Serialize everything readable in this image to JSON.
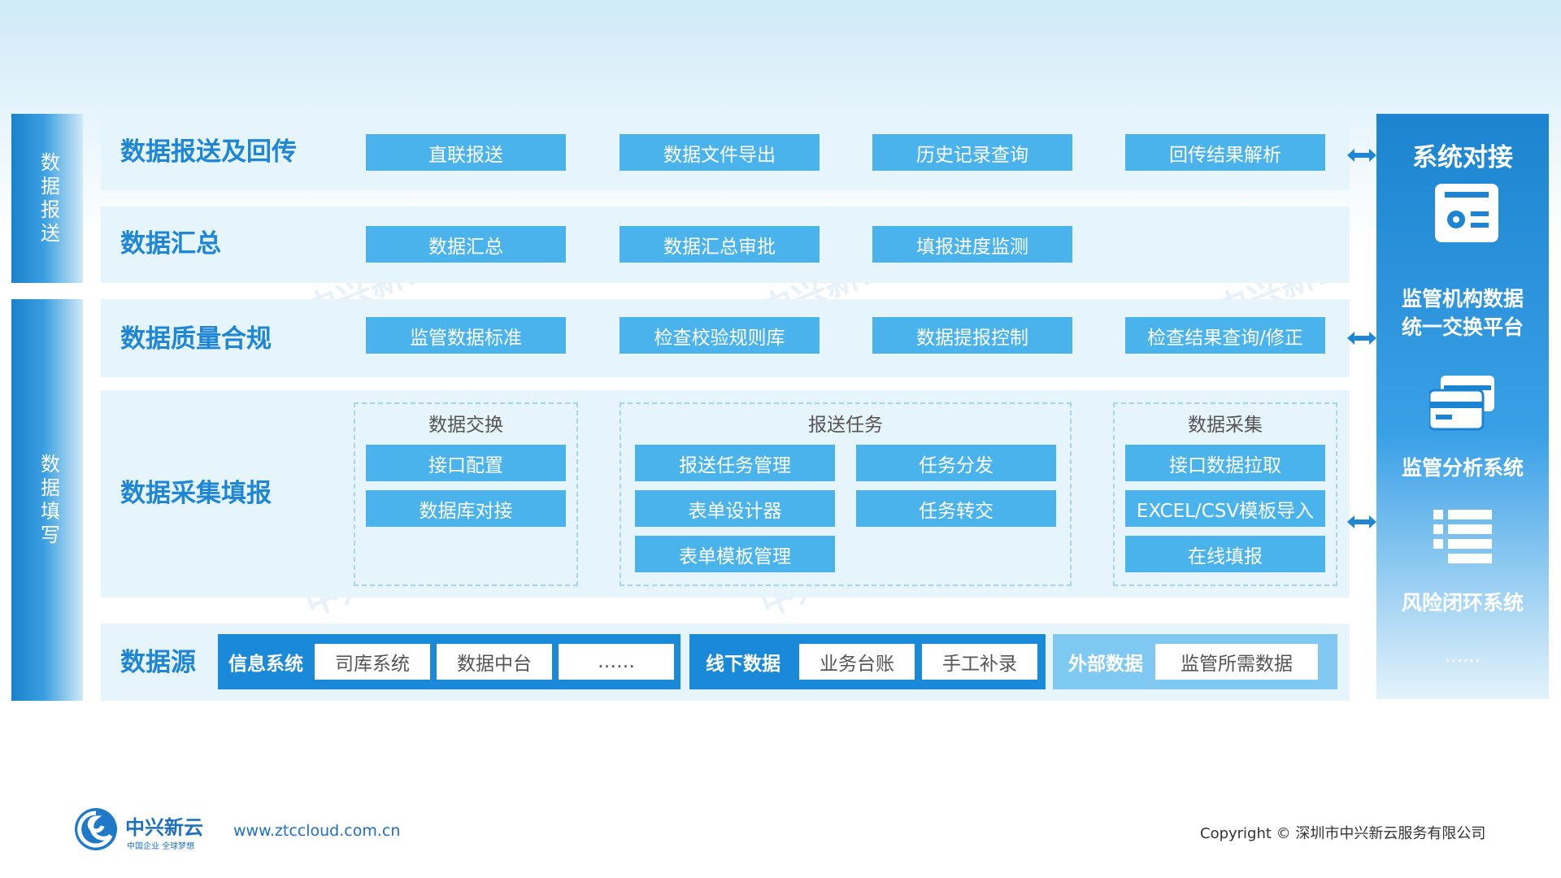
{
  "sidebar": {
    "report_label": [
      "数",
      "据",
      "报",
      "送"
    ],
    "fill_label": [
      "数",
      "据",
      "填",
      "写"
    ]
  },
  "rows": {
    "report": {
      "title": "数据报送及回传",
      "buttons": [
        "直联报送",
        "数据文件导出",
        "历史记录查询",
        "回传结果解析"
      ]
    },
    "summary": {
      "title": "数据汇总",
      "buttons": [
        "数据汇总",
        "数据汇总审批",
        "填报进度监测"
      ]
    },
    "quality": {
      "title": "数据质量合规",
      "buttons": [
        "监管数据标准",
        "检查校验规则库",
        "数据提报控制",
        "检查结果查询/修正"
      ]
    },
    "collect": {
      "title": "数据采集填报",
      "groups": {
        "exchange": {
          "title": "数据交换",
          "buttons": [
            "接口配置",
            "数据库对接"
          ]
        },
        "task": {
          "title": "报送任务",
          "buttons": [
            "报送任务管理",
            "任务分发",
            "表单设计器",
            "任务转交",
            "表单模板管理"
          ]
        },
        "gather": {
          "title": "数据采集",
          "buttons": [
            "接口数据拉取",
            "EXCEL/CSV模板导入",
            "在线填报"
          ]
        }
      }
    },
    "source": {
      "title": "数据源",
      "info": {
        "label": "信息系统",
        "items": [
          "司库系统",
          "数据中台",
          "……"
        ]
      },
      "offline": {
        "label": "线下数据",
        "items": [
          "业务台账",
          "手工补录"
        ]
      },
      "external": {
        "label": "外部数据",
        "items": [
          "监管所需数据"
        ]
      }
    }
  },
  "right_panel": {
    "title": "系统对接",
    "systems": [
      "监管机构数据统一交换平台",
      "监管分析系统",
      "风险闭环系统"
    ],
    "more": "……",
    "icons": [
      "settings-card-icon",
      "cards-icon",
      "list-icon"
    ]
  },
  "watermark": "中兴新云",
  "footer": {
    "logo_text": "中兴新云",
    "logo_sub": "中国企业 全球梦想",
    "url": "www.ztccloud.com.cn",
    "copyright": "Copyright © 深圳市中兴新云服务有限公司"
  },
  "colors": {
    "accent": "#1f86d4",
    "button": "#4bb3ec",
    "panel": "#1c84d0",
    "row_bg": "#e6f4fc"
  }
}
